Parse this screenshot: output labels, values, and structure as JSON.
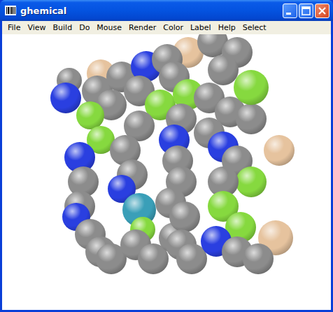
{
  "window": {
    "title": "ghemical"
  },
  "menu": [
    {
      "label": "File"
    },
    {
      "label": "View"
    },
    {
      "label": "Build"
    },
    {
      "label": "Do"
    },
    {
      "label": "Mouse"
    },
    {
      "label": "Render"
    },
    {
      "label": "Color"
    },
    {
      "label": "Label"
    },
    {
      "label": "Help"
    },
    {
      "label": "Select"
    }
  ],
  "viewport": {
    "atoms": [
      {
        "color": "#e6c39e"
      },
      {
        "color": "#e6c39e"
      },
      {
        "color": "#e6c39e"
      },
      {
        "color": "#e6c39e"
      },
      {
        "color": "#8c8c8c"
      },
      {
        "color": "#2a3fe0"
      },
      {
        "color": "#8c8c8c"
      },
      {
        "color": "#8c8c8c"
      },
      {
        "color": "#8c8c8c"
      },
      {
        "color": "#86d93f"
      },
      {
        "color": "#86d93f"
      },
      {
        "color": "#2a3fe0"
      },
      {
        "color": "#8c8c8c"
      },
      {
        "color": "#8c8c8c"
      },
      {
        "color": "#2a3fe0"
      },
      {
        "color": "#8c8c8c"
      },
      {
        "color": "#8c8c8c"
      },
      {
        "color": "#8c8c8c"
      },
      {
        "color": "#2a3fe0"
      },
      {
        "color": "#8c8c8c"
      },
      {
        "color": "#86d93f"
      },
      {
        "color": "#8c8c8c"
      },
      {
        "color": "#8c8c8c"
      },
      {
        "color": "#8c8c8c"
      },
      {
        "color": "#2a3fe0"
      },
      {
        "color": "#3a9fb8"
      },
      {
        "color": "#86d93f"
      },
      {
        "color": "#8c8c8c"
      },
      {
        "color": "#8c8c8c"
      },
      {
        "color": "#8c8c8c"
      },
      {
        "color": "#8c8c8c"
      },
      {
        "color": "#8c8c8c"
      },
      {
        "color": "#86d93f"
      },
      {
        "color": "#8c8c8c"
      },
      {
        "color": "#2a3fe0"
      },
      {
        "color": "#8c8c8c"
      },
      {
        "color": "#8c8c8c"
      },
      {
        "color": "#8c8c8c"
      },
      {
        "color": "#8c8c8c"
      },
      {
        "color": "#8c8c8c"
      },
      {
        "color": "#8c8c8c"
      },
      {
        "color": "#8c8c8c"
      },
      {
        "color": "#8c8c8c"
      },
      {
        "color": "#8c8c8c"
      },
      {
        "color": "#8c8c8c"
      },
      {
        "color": "#8c8c8c"
      },
      {
        "color": "#8c8c8c"
      },
      {
        "color": "#8c8c8c"
      },
      {
        "color": "#2a3fe0"
      },
      {
        "color": "#8c8c8c"
      },
      {
        "color": "#86d93f"
      },
      {
        "color": "#8c8c8c"
      },
      {
        "color": "#86d93f"
      },
      {
        "color": "#86d93f"
      },
      {
        "color": "#2a3fe0"
      },
      {
        "color": "#8c8c8c"
      },
      {
        "color": "#8c8c8c"
      },
      {
        "color": "#86d93f"
      }
    ]
  }
}
